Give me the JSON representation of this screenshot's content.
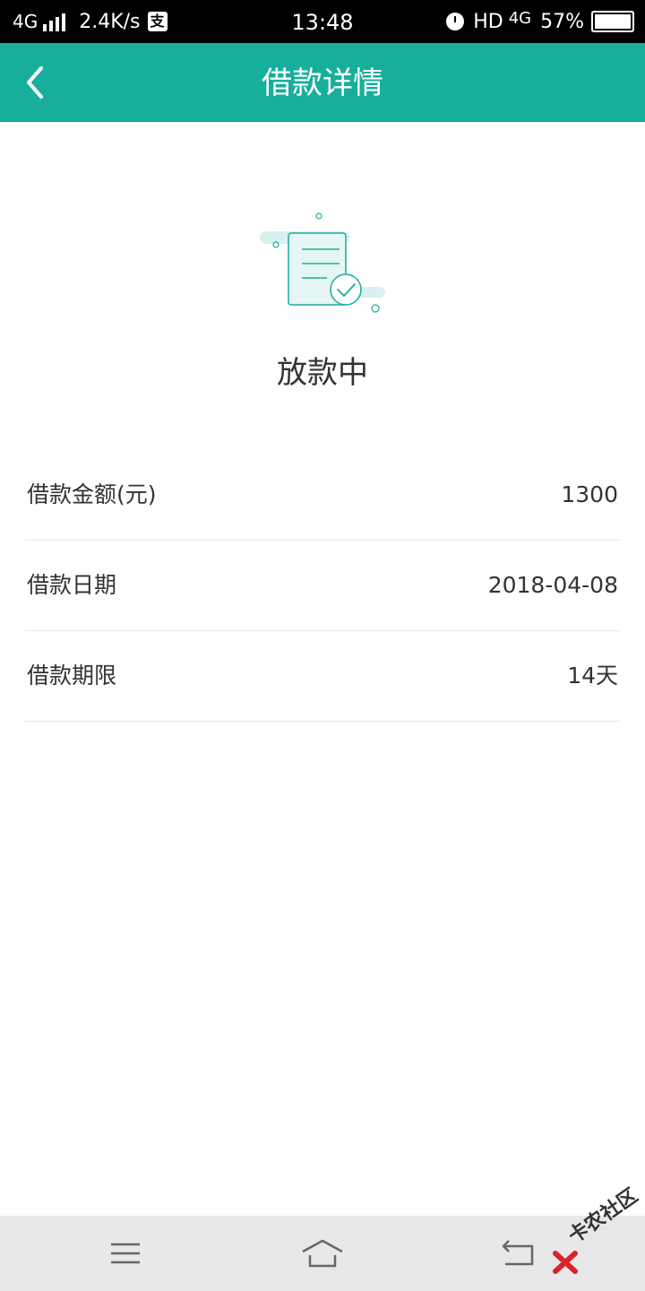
{
  "status_bar": {
    "network": "4G",
    "speed": "2.4K/s",
    "app_glyph": "支",
    "time": "13:48",
    "hd": "HD",
    "network_right": "4G",
    "battery": "57%",
    "icons": [
      "signal-icon",
      "alipay-icon",
      "alarm-icon",
      "battery-icon"
    ]
  },
  "header": {
    "title": "借款详情",
    "back_icon": "chevron-left-icon"
  },
  "status": {
    "text": "放款中",
    "icon": "document-check-icon"
  },
  "details": [
    {
      "label": "借款金额(元)",
      "value": "1300"
    },
    {
      "label": "借款日期",
      "value": "2018-04-08"
    },
    {
      "label": "借款期限",
      "value": "14天"
    }
  ],
  "nav_bar": {
    "icons": [
      "menu-icon",
      "home-icon",
      "back-arrow-icon"
    ]
  },
  "watermark": {
    "text": "卡农社区"
  },
  "colors": {
    "accent": "#17ae9c",
    "status_bar": "#000000",
    "nav_bar": "#e8e8e8",
    "text": "#333333"
  }
}
